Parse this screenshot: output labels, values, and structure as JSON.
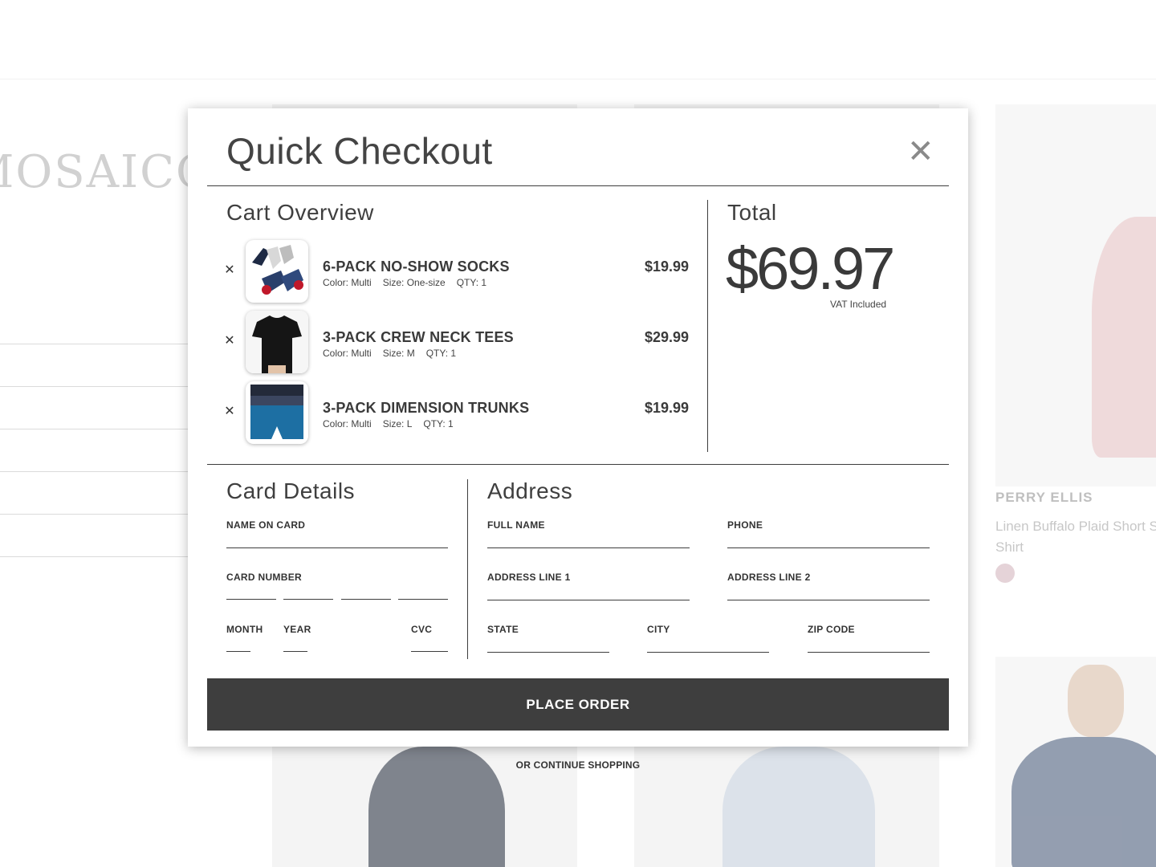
{
  "background": {
    "brand_logo": "MOSAICO",
    "product": {
      "brand": "PERRY ELLIS",
      "title": "Linen Buffalo Plaid Short Sleeve Shirt"
    }
  },
  "modal": {
    "title": "Quick Checkout",
    "close_icon": "close-icon"
  },
  "cart": {
    "title": "Cart Overview",
    "items": [
      {
        "name": "6-PACK NO-SHOW SOCKS",
        "color": "Color: Multi",
        "size": "Size: One-size",
        "qty": "QTY: 1",
        "price": "$19.99",
        "image_icon": "socks-image"
      },
      {
        "name": "3-PACK CREW NECK TEES",
        "color": "Color: Multi",
        "size": "Size: M",
        "qty": "QTY: 1",
        "price": "$29.99",
        "image_icon": "tee-image"
      },
      {
        "name": "3-PACK DIMENSION TRUNKS",
        "color": "Color: Multi",
        "size": "Size: L",
        "qty": "QTY: 1",
        "price": "$19.99",
        "image_icon": "trunks-image"
      }
    ],
    "remove_icon": "close-icon"
  },
  "total": {
    "title": "Total",
    "amount": "$69.97",
    "note": "VAT Included"
  },
  "card": {
    "title": "Card Details",
    "name_label": "NAME ON CARD",
    "number_label": "CARD NUMBER",
    "month_label": "MONTH",
    "year_label": "YEAR",
    "cvc_label": "CVC"
  },
  "address": {
    "title": "Address",
    "full_name_label": "FULL NAME",
    "phone_label": "PHONE",
    "line1_label": "ADDRESS LINE 1",
    "line2_label": "ADDRESS LINE 2",
    "state_label": "STATE",
    "city_label": "CITY",
    "zip_label": "ZIP CODE"
  },
  "actions": {
    "place_order": "PLACE ORDER",
    "continue_shopping": "OR CONTINUE SHOPPING"
  },
  "colors": {
    "button_bg": "#3e3e3e",
    "text": "#3a3a3a",
    "divider": "#3d3d3d"
  }
}
